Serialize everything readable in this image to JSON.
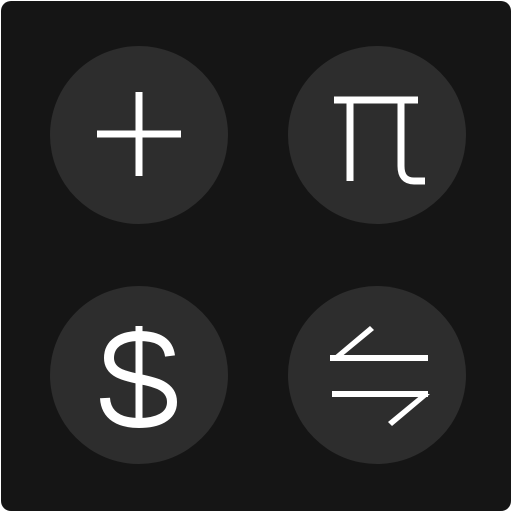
{
  "app": {
    "background": "#151515",
    "button_color": "#2d2d2d",
    "icon_color": "#ffffff"
  },
  "buttons": [
    {
      "icon": "plus-icon"
    },
    {
      "icon": "pi-icon"
    },
    {
      "icon": "dollar-icon"
    },
    {
      "icon": "swap-arrows-icon"
    }
  ]
}
